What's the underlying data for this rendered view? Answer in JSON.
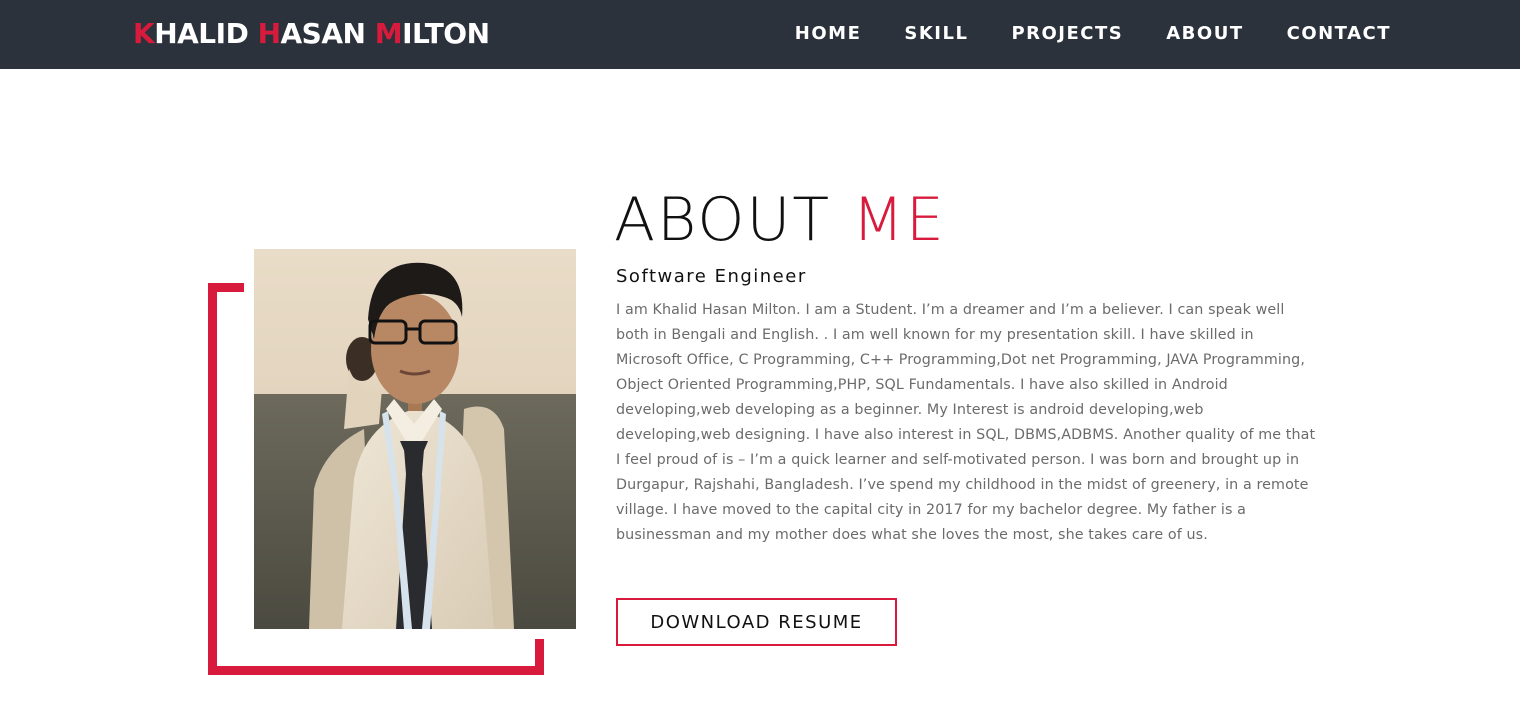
{
  "brand": {
    "k": "K",
    "halid": "HALID ",
    "h": "H",
    "asan": "ASAN ",
    "m": "M",
    "ilton": "ILTON"
  },
  "nav": {
    "items": [
      "HOME",
      "SKILL",
      "PROJECTS",
      "ABOUT",
      "CONTACT"
    ]
  },
  "about": {
    "title_plain": "ABOUT ",
    "title_accent": "ME",
    "subtitle": "Software Engineer",
    "bio": "I am Khalid Hasan Milton. I am a Student. I’m a dreamer and I’m a believer. I can speak well both in Bengali and English. . I am well known for my presentation skill. I have skilled in Microsoft Office, C Programming, C++ Programming,Dot net Programming, JAVA Programming, Object Oriented Programming,PHP, SQL Fundamentals. I have also skilled in Android developing,web developing as a beginner. My Interest is android developing,web developing,web designing. I have also interest in SQL, DBMS,ADBMS. Another quality of me that I feel proud of is – I’m a quick learner and self-motivated person. I was born and brought up in Durgapur, Rajshahi, Bangladesh. I’ve spend my childhood in the midst of greenery, in a remote village. I have moved to the capital city in 2017 for my bachelor degree. My father is a businessman and my mother does what she loves the most, she takes care of us.",
    "resume_button": "DOWNLOAD RESUME"
  },
  "colors": {
    "navbar_bg": "#2b323c",
    "accent": "#d81b3c",
    "text": "#111111",
    "body_text": "#6b6b6b"
  }
}
